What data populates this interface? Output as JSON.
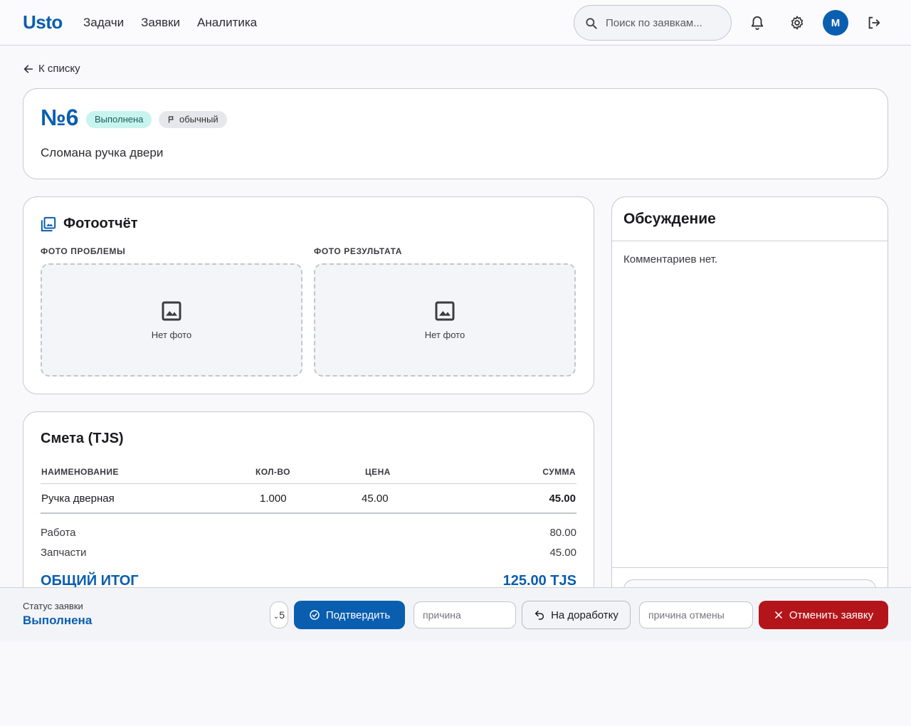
{
  "header": {
    "logo": "Usto",
    "nav": [
      "Задачи",
      "Заявки",
      "Аналитика"
    ],
    "search_placeholder": "Поиск по заявкам...",
    "avatar_initial": "M"
  },
  "back_label": "К списку",
  "request": {
    "number": "№6",
    "status_badge": "Выполнена",
    "priority_badge": "обычный",
    "description": "Сломана ручка двери"
  },
  "photos": {
    "title": "Фотоотчёт",
    "problem_label": "ФОТО ПРОБЛЕМЫ",
    "result_label": "ФОТО РЕЗУЛЬТАТА",
    "no_photo": "Нет фото"
  },
  "estimate": {
    "title": "Смета (TJS)",
    "columns": [
      "НАИМЕНОВАНИЕ",
      "КОЛ-ВО",
      "ЦЕНА",
      "СУММА"
    ],
    "rows": [
      {
        "name": "Ручка дверная",
        "qty": "1.000",
        "price": "45.00",
        "sum": "45.00"
      }
    ],
    "work_label": "Работа",
    "work_value": "80.00",
    "parts_label": "Запчасти",
    "parts_value": "45.00",
    "total_label": "ОБЩИЙ ИТОГ",
    "total_value": "125.00 TJS"
  },
  "discussion": {
    "title": "Обсуждение",
    "empty_text": "Комментариев нет."
  },
  "actionbar": {
    "status_label": "Статус заявки",
    "status_value": "Выполнена",
    "rating_stub": "5",
    "confirm_label": "Подтвердить",
    "rework_placeholder": "причина",
    "rework_label": "На доработку",
    "cancel_placeholder": "причина отмены",
    "cancel_label": "Отменить заявку"
  },
  "colors": {
    "primary": "#0a5eb0",
    "danger": "#b3151a",
    "status_badge_bg": "#c8f4ef"
  }
}
